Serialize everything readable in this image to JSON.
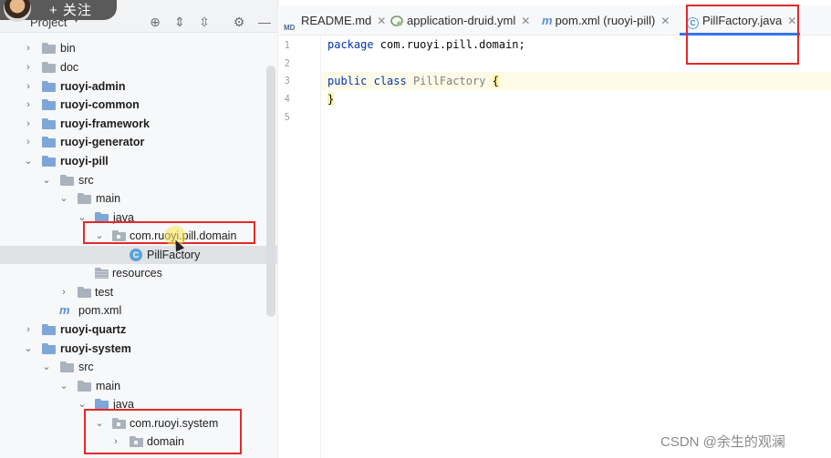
{
  "overlay": {
    "follow_label": "+ 关注"
  },
  "project_panel": {
    "title": "Project",
    "icons": [
      "target-icon",
      "expand-all-icon",
      "collapse-all-icon",
      "gear-icon",
      "minimize-icon"
    ],
    "tree": [
      {
        "label": "bin",
        "bold": false,
        "expanded": false
      },
      {
        "label": "doc",
        "bold": false,
        "expanded": false
      },
      {
        "label": "ruoyi-admin",
        "bold": true,
        "expanded": false
      },
      {
        "label": "ruoyi-common",
        "bold": true,
        "expanded": false
      },
      {
        "label": "ruoyi-framework",
        "bold": true,
        "expanded": false
      },
      {
        "label": "ruoyi-generator",
        "bold": true,
        "expanded": false
      },
      {
        "label": "ruoyi-pill",
        "bold": true,
        "expanded": true
      },
      {
        "label": "src",
        "bold": false,
        "expanded": true
      },
      {
        "label": "main",
        "bold": false,
        "expanded": true
      },
      {
        "label": "java",
        "bold": false,
        "expanded": true
      },
      {
        "label": "com.ruoyi.pill.domain",
        "bold": false,
        "expanded": true
      },
      {
        "label": "PillFactory",
        "bold": false,
        "selected": true
      },
      {
        "label": "resources",
        "bold": false
      },
      {
        "label": "test",
        "bold": false,
        "expanded": false
      },
      {
        "label": "pom.xml",
        "bold": false
      },
      {
        "label": "ruoyi-quartz",
        "bold": true,
        "expanded": false
      },
      {
        "label": "ruoyi-system",
        "bold": true,
        "expanded": true
      },
      {
        "label": "src",
        "bold": false,
        "expanded": true
      },
      {
        "label": "main",
        "bold": false,
        "expanded": true
      },
      {
        "label": "java",
        "bold": false,
        "expanded": true
      },
      {
        "label": "com.ruoyi.system",
        "bold": false,
        "expanded": true
      },
      {
        "label": "domain",
        "bold": false,
        "expanded": false
      }
    ]
  },
  "editor": {
    "tabs": [
      {
        "label": "README.md",
        "icon": "markdown-file-icon",
        "active": false
      },
      {
        "label": "application-druid.yml",
        "icon": "yaml-file-icon",
        "active": false
      },
      {
        "label": "pom.xml (ruoyi-pill)",
        "icon": "maven-file-icon",
        "active": false
      },
      {
        "label": "PillFactory.java",
        "icon": "java-class-icon",
        "active": true
      }
    ],
    "line_numbers": [
      "1",
      "2",
      "3",
      "4",
      "5"
    ],
    "code": {
      "line1_kw": "package",
      "line1_rest": " com.ruoyi.pill.domain;",
      "line3_kw1": "public",
      "line3_kw2": "class",
      "line3_name": "PillFactory",
      "line3_brace": "{",
      "line4_brace": "}"
    }
  },
  "watermark": "CSDN @余生的观澜",
  "colors": {
    "highlight_box": "#e22a2a",
    "active_tab_underline": "#3574f0",
    "keyword": "#0033b3"
  }
}
